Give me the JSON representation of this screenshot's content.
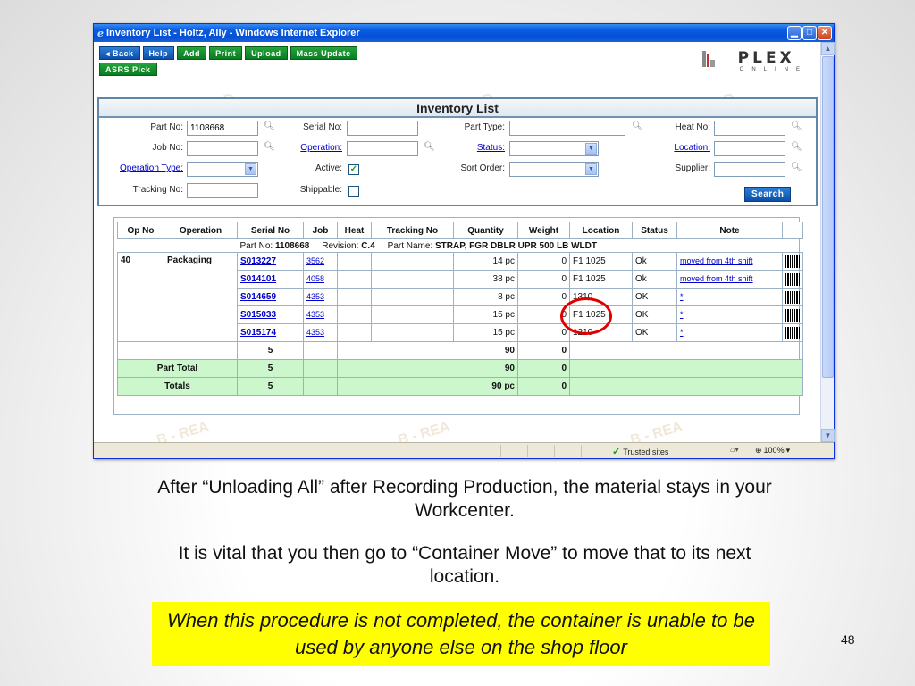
{
  "window": {
    "title": "Inventory List - Holtz, Ally - Windows Internet Explorer"
  },
  "toolbar": {
    "back": "◂ Back",
    "help": "Help",
    "add": "Add",
    "print": "Print",
    "upload": "Upload",
    "mass_update": "Mass Update",
    "asrs_pick": "ASRS Pick"
  },
  "logo": {
    "word": "PLEX",
    "sub": "ONLINE"
  },
  "panel": {
    "title": "Inventory List",
    "labels": {
      "part_no": "Part No:",
      "serial_no": "Serial No:",
      "part_type": "Part Type:",
      "heat_no": "Heat No:",
      "job_no": "Job No:",
      "operation": "Operation:",
      "status": "Status:",
      "location": "Location:",
      "operation_type": "Operation Type:",
      "active": "Active:",
      "sort_order": "Sort Order:",
      "supplier": "Supplier:",
      "tracking_no": "Tracking No:",
      "shippable": "Shippable:"
    },
    "values": {
      "part_no": "1108668"
    },
    "active_checked": "✓",
    "search": "Search"
  },
  "table": {
    "headers": [
      "Op No",
      "Operation",
      "Serial No",
      "Job",
      "Heat",
      "Tracking No",
      "Quantity",
      "Weight",
      "Location",
      "Status",
      "Note"
    ],
    "part_header": {
      "part_no_label": "Part No:",
      "part_no": "1108668",
      "revision_label": "Revision:",
      "revision": "C.4",
      "part_name_label": "Part Name:",
      "part_name": "STRAP, FGR DBLR UPR 500 LB WLDT"
    },
    "op_no": "40",
    "operation": "Packaging",
    "rows": [
      {
        "serial": "S013227",
        "job": "3562",
        "qty": "14 pc",
        "weight": "0",
        "location": "F1 1025",
        "status": "Ok",
        "note": "moved from 4th shift"
      },
      {
        "serial": "S014101",
        "job": "4058",
        "qty": "38 pc",
        "weight": "0",
        "location": "F1 1025",
        "status": "Ok",
        "note": "moved from 4th shift"
      },
      {
        "serial": "S014659",
        "job": "4353",
        "qty": "8 pc",
        "weight": "0",
        "location": "1310",
        "status": "OK",
        "note": "*"
      },
      {
        "serial": "S015033",
        "job": "4353",
        "qty": "15 pc",
        "weight": "0",
        "location": "F1 1025",
        "status": "OK",
        "note": "*"
      },
      {
        "serial": "S015174",
        "job": "4353",
        "qty": "15 pc",
        "weight": "0",
        "location": "1210",
        "status": "OK",
        "note": "*"
      }
    ],
    "sub_count": "5",
    "sub_qty": "90",
    "sub_weight": "0",
    "part_total": {
      "label": "Part Total",
      "count": "5",
      "qty": "90",
      "weight": "0"
    },
    "totals": {
      "label": "Totals",
      "count": "5",
      "qty": "90 pc",
      "weight": "0"
    }
  },
  "statusbar": {
    "trusted": "Trusted sites",
    "zoom": "100%"
  },
  "slide": {
    "caption1": "After “Unloading All” after Recording  Production, the material stays in your Workcenter.",
    "caption2": "It is vital that you then go to “Container Move” to move that to its next location.",
    "note": "When this procedure is not completed, the container is unable to be used by anyone else on the shop floor",
    "page_number": "48"
  },
  "colors": {
    "titlebar": "#0a5ee3",
    "button_green": "#0b7c22",
    "button_blue": "#0d4fa8",
    "highlight": "#ffff00",
    "total_row": "#ccf6cc",
    "ring": "#e00000"
  },
  "icons": [
    "ie-icon",
    "minimize-icon",
    "maximize-icon",
    "close-icon",
    "binoculars-icon",
    "dropdown-arrow-icon",
    "checkmark-icon",
    "barcode-icon",
    "plex-logo-icon"
  ]
}
